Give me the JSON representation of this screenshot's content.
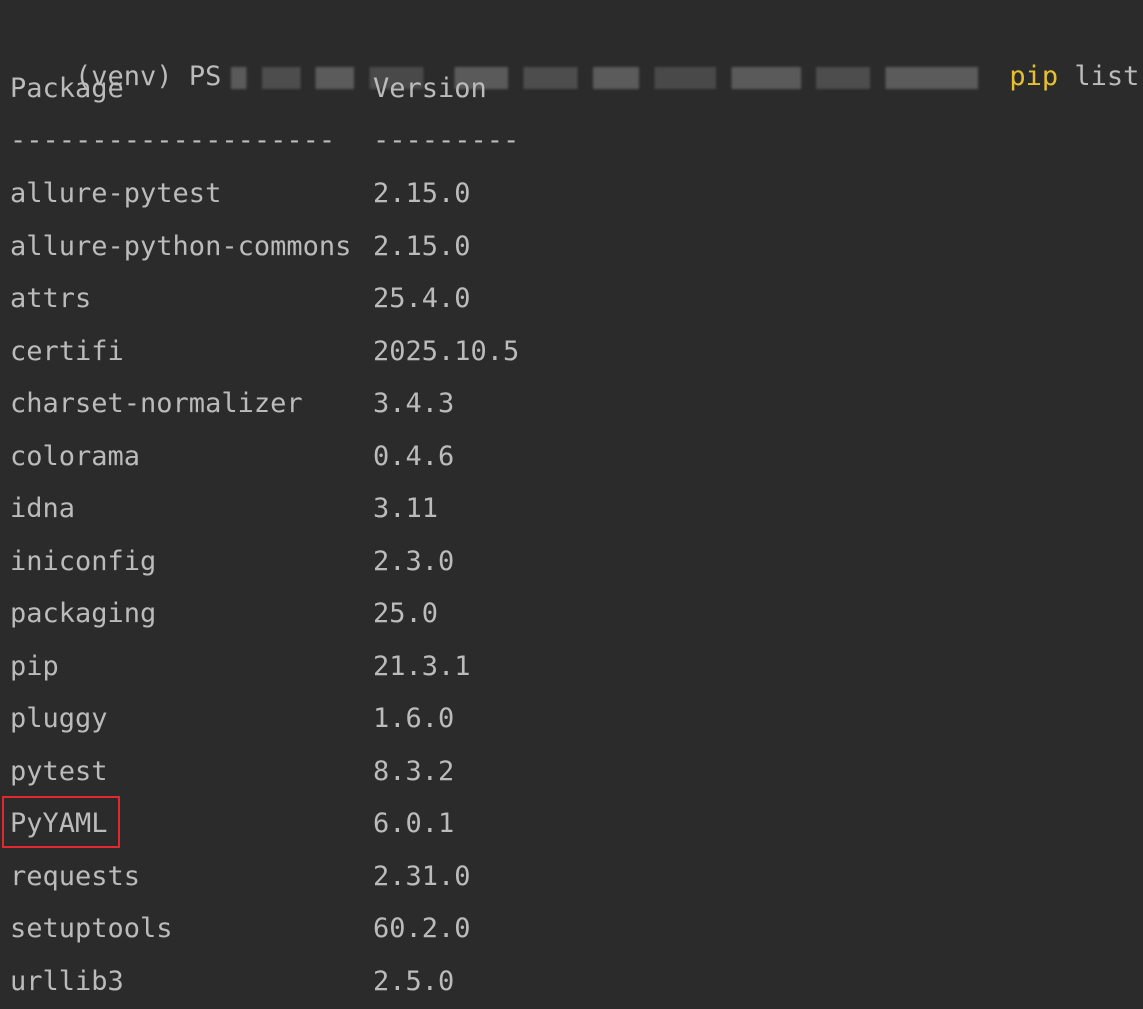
{
  "prompt": {
    "prefix": "(venv) PS",
    "command": "pip",
    "args": "list"
  },
  "table": {
    "headers": {
      "package": "Package",
      "version": "Version"
    },
    "separators": {
      "package": "--------------------",
      "version": "---------"
    },
    "rows": [
      {
        "package": "allure-pytest",
        "version": "2.15.0"
      },
      {
        "package": "allure-python-commons",
        "version": "2.15.0"
      },
      {
        "package": "attrs",
        "version": "25.4.0"
      },
      {
        "package": "certifi",
        "version": "2025.10.5"
      },
      {
        "package": "charset-normalizer",
        "version": "3.4.3"
      },
      {
        "package": "colorama",
        "version": "0.4.6"
      },
      {
        "package": "idna",
        "version": "3.11"
      },
      {
        "package": "iniconfig",
        "version": "2.3.0"
      },
      {
        "package": "packaging",
        "version": "25.0"
      },
      {
        "package": "pip",
        "version": "21.3.1"
      },
      {
        "package": "pluggy",
        "version": "1.6.0"
      },
      {
        "package": "pytest",
        "version": "8.3.2"
      },
      {
        "package": "PyYAML",
        "version": "6.0.1"
      },
      {
        "package": "requests",
        "version": "2.31.0"
      },
      {
        "package": "setuptools",
        "version": "60.2.0"
      },
      {
        "package": "urllib3",
        "version": "2.5.0"
      }
    ]
  },
  "colors": {
    "background": "#2b2b2b",
    "text": "#bbbbbb",
    "command": "#e6c02e",
    "highlight_border": "#e0282e"
  }
}
